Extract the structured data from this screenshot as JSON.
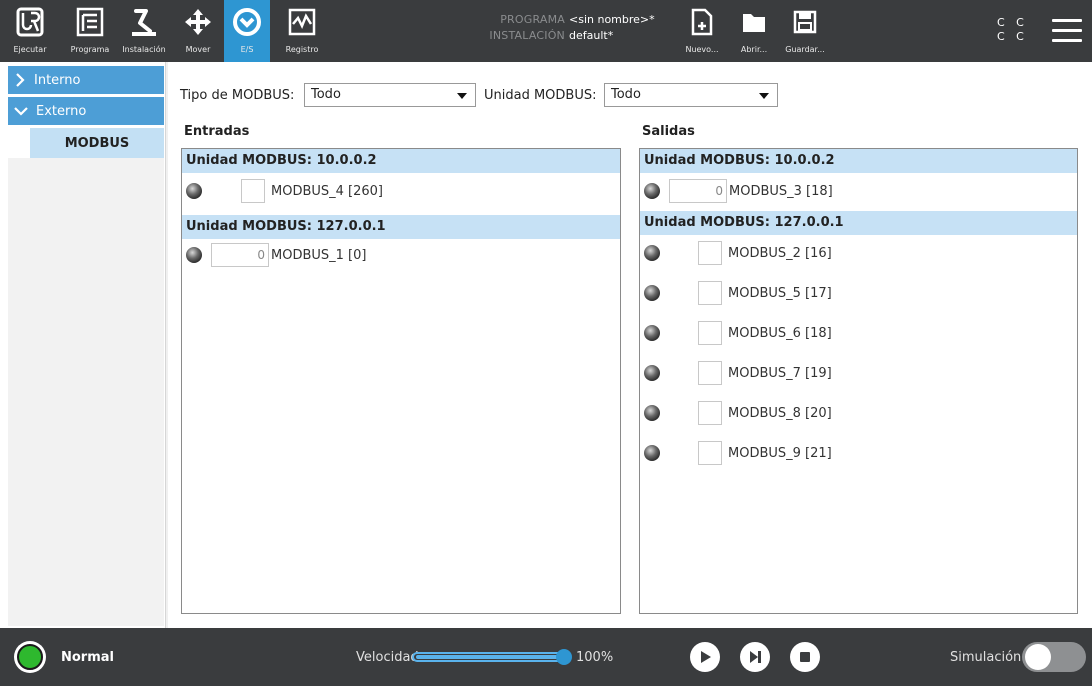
{
  "topbar": {
    "tabs": [
      {
        "label": "Ejecutar",
        "icon": "ur-logo-icon"
      },
      {
        "label": "Programa",
        "icon": "program-tree-icon"
      },
      {
        "label": "Instalación",
        "icon": "robot-arm-icon"
      },
      {
        "label": "Mover",
        "icon": "move-arrows-icon"
      },
      {
        "label": "E/S",
        "icon": "io-icon",
        "active": true
      },
      {
        "label": "Registro",
        "icon": "log-pulse-icon"
      }
    ],
    "program_key": "PROGRAMA",
    "program_value": "<sin nombre>*",
    "installation_key": "INSTALACIÓN",
    "installation_value": "default*",
    "file_buttons": [
      {
        "label": "Nuevo...",
        "icon": "new-file-icon"
      },
      {
        "label": "Abrir...",
        "icon": "folder-icon"
      },
      {
        "label": "Guardar...",
        "icon": "save-icon"
      }
    ],
    "cc_line1": "C C",
    "cc_line2": "C C"
  },
  "sidebar": {
    "items": [
      {
        "label": "Interno",
        "expanded": false
      },
      {
        "label": "Externo",
        "expanded": true
      }
    ],
    "sub_item": "MODBUS"
  },
  "filters": {
    "type_label": "Tipo de MODBUS:",
    "type_value": "Todo",
    "unit_label": "Unidad MODBUS:",
    "unit_value": "Todo"
  },
  "inputs": {
    "title": "Entradas",
    "units": [
      {
        "header": "Unidad MODBUS: 10.0.0.2",
        "signals": [
          {
            "kind": "checkbox",
            "name": "MODBUS_4 [260]"
          }
        ]
      },
      {
        "header": "Unidad MODBUS: 127.0.0.1",
        "signals": [
          {
            "kind": "register",
            "value": "0",
            "name": "MODBUS_1 [0]"
          }
        ]
      }
    ]
  },
  "outputs": {
    "title": "Salidas",
    "units": [
      {
        "header": "Unidad MODBUS: 10.0.0.2",
        "signals": [
          {
            "kind": "register",
            "value": "0",
            "name": "MODBUS_3 [18]"
          }
        ]
      },
      {
        "header": "Unidad MODBUS: 127.0.0.1",
        "signals": [
          {
            "kind": "checkbox",
            "name": "MODBUS_2 [16]"
          },
          {
            "kind": "checkbox",
            "name": "MODBUS_5 [17]"
          },
          {
            "kind": "checkbox",
            "name": "MODBUS_6 [18]"
          },
          {
            "kind": "checkbox",
            "name": "MODBUS_7 [19]"
          },
          {
            "kind": "checkbox",
            "name": "MODBUS_8 [20]"
          },
          {
            "kind": "checkbox",
            "name": "MODBUS_9 [21]"
          }
        ]
      }
    ]
  },
  "bottombar": {
    "status": "Normal",
    "status_color": "#2eb82e",
    "speed_label": "Velocidad",
    "speed_value": "100%",
    "speed_fraction": 1.0,
    "controls": [
      "play-icon",
      "step-icon",
      "stop-icon"
    ],
    "simulation_label": "Simulación",
    "simulation_on": false
  },
  "colors": {
    "topbar_bg": "#3a3c3e",
    "accent": "#2e96d2",
    "nav_blue": "#4d9ed6",
    "unit_header_bg": "#c6e1f5"
  }
}
